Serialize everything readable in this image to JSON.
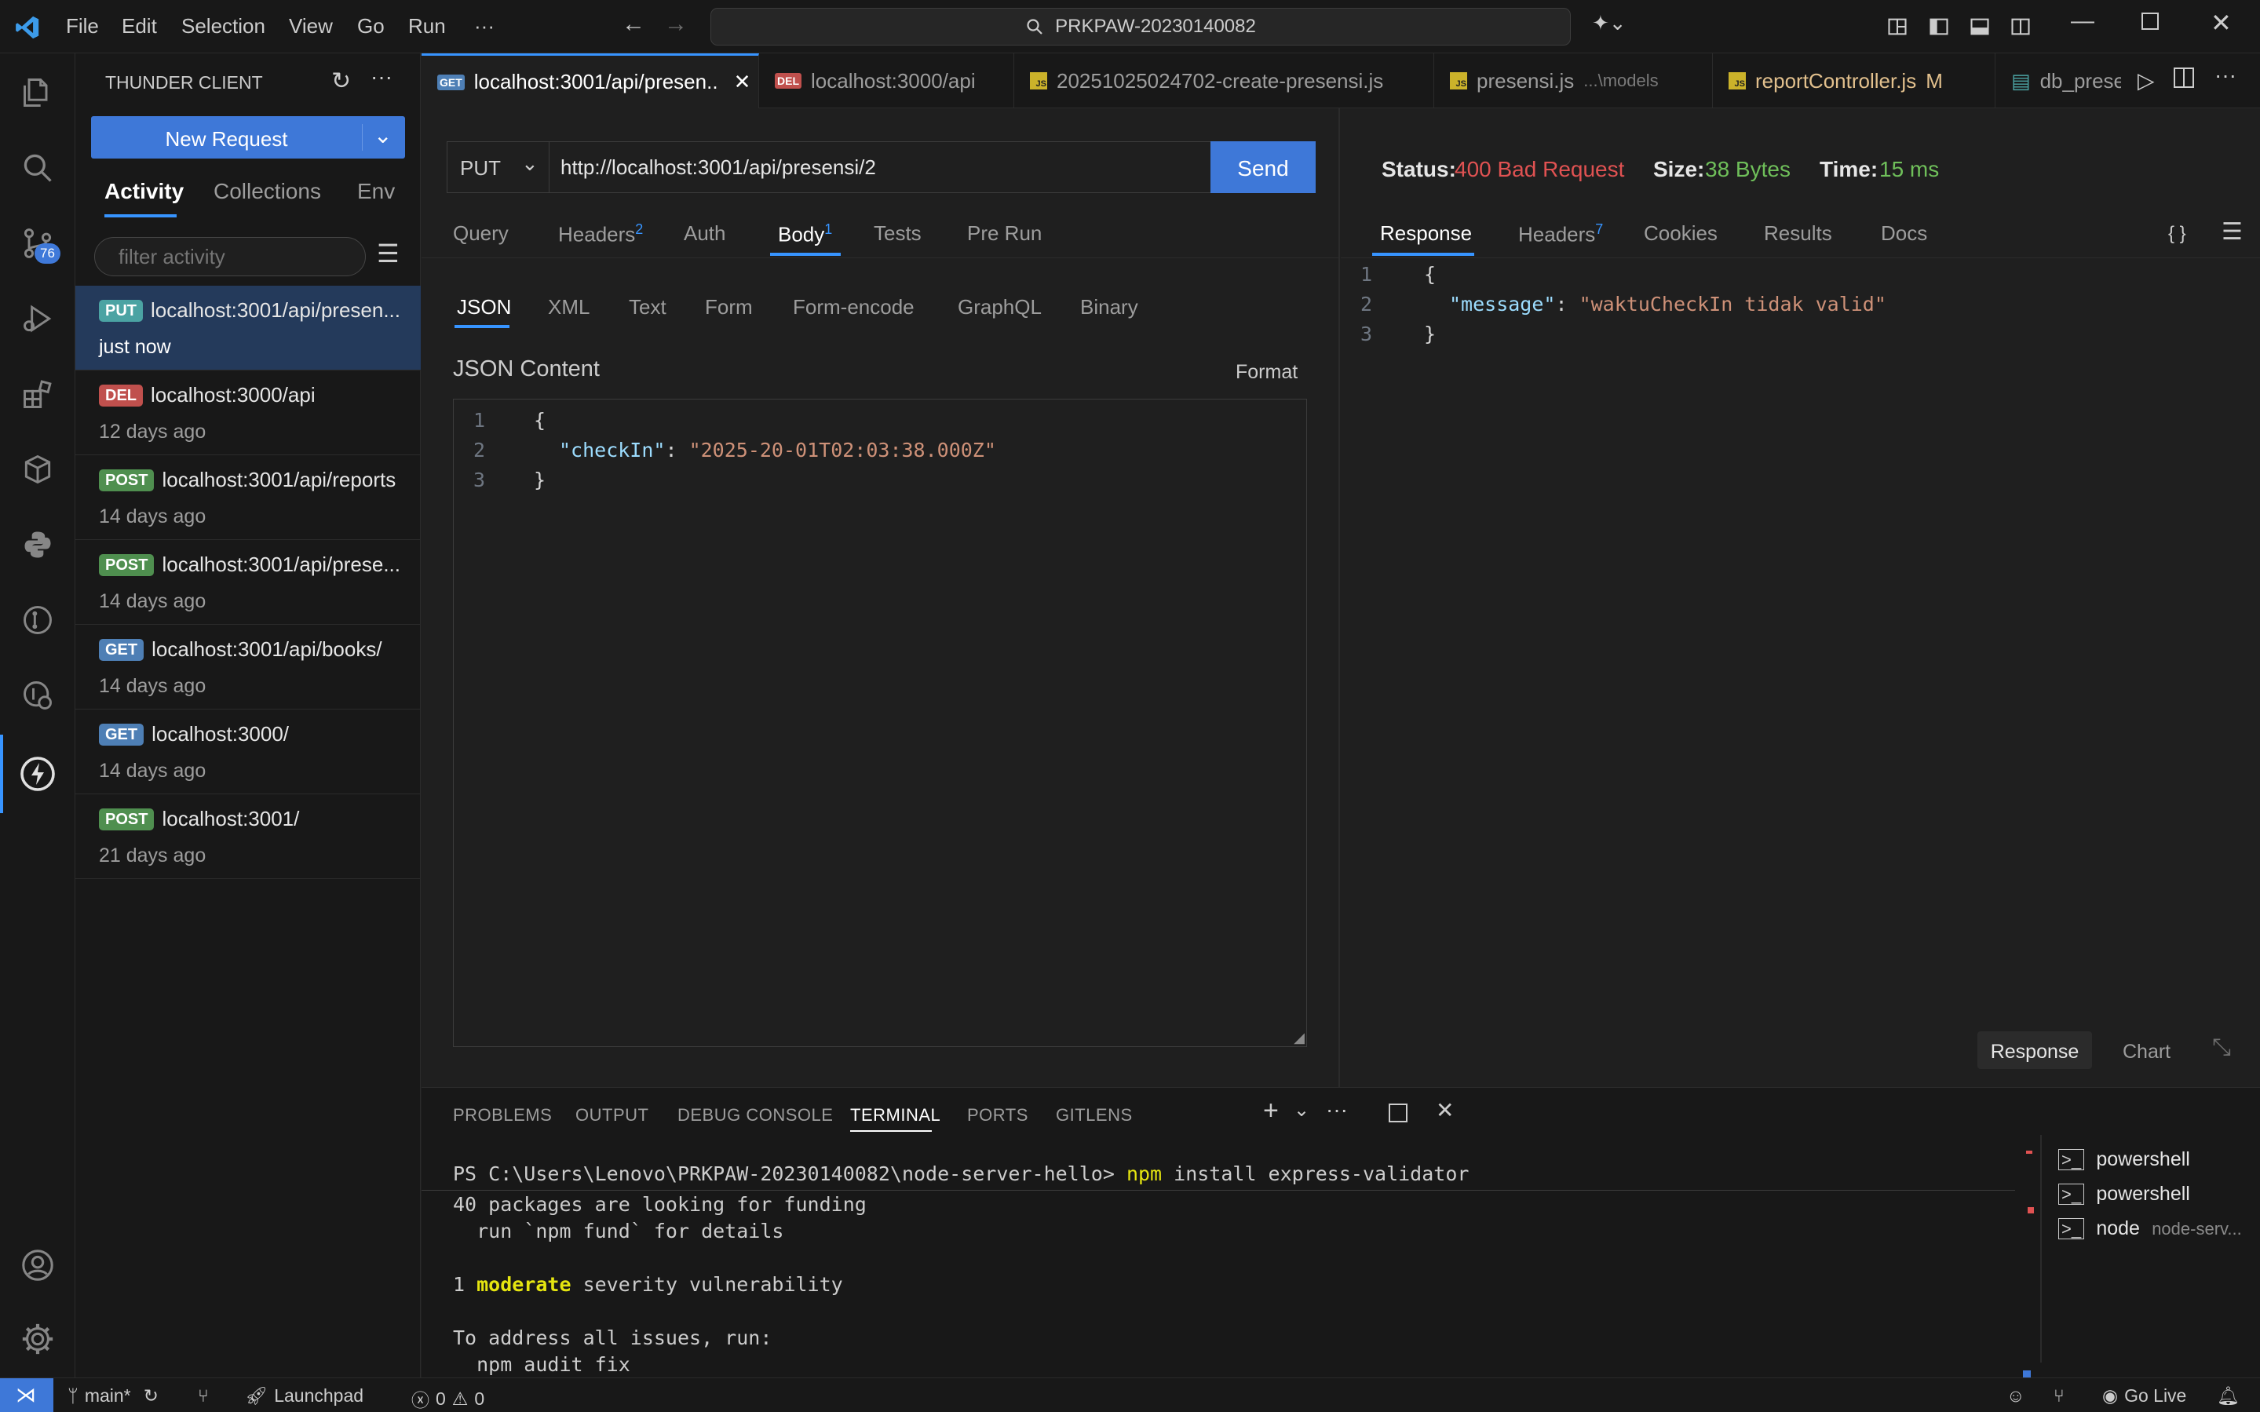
{
  "menu": [
    "File",
    "Edit",
    "Selection",
    "View",
    "Go",
    "Run",
    "···"
  ],
  "search": {
    "text": "PRKPAW-20230140082"
  },
  "activity": {
    "badge": "76"
  },
  "sidebar": {
    "title": "THUNDER CLIENT",
    "new_request": "New Request",
    "tabs": [
      "Activity",
      "Collections",
      "Env"
    ],
    "filter_placeholder": "filter activity",
    "history": [
      {
        "method": "PUT",
        "color": "#4ba3a3",
        "url": "localhost:3001/api/presen...",
        "time": "just now"
      },
      {
        "method": "DEL",
        "color": "#c0504d",
        "url": "localhost:3000/api",
        "time": "12 days ago"
      },
      {
        "method": "POST",
        "color": "#4f8f4f",
        "url": "localhost:3001/api/reports",
        "time": "14 days ago"
      },
      {
        "method": "POST",
        "color": "#4f8f4f",
        "url": "localhost:3001/api/prese...",
        "time": "14 days ago"
      },
      {
        "method": "GET",
        "color": "#4e7fb5",
        "url": "localhost:3001/api/books/",
        "time": "14 days ago"
      },
      {
        "method": "GET",
        "color": "#4e7fb5",
        "url": "localhost:3000/",
        "time": "14 days ago"
      },
      {
        "method": "POST",
        "color": "#4f8f4f",
        "url": "localhost:3001/",
        "time": "21 days ago"
      }
    ]
  },
  "tabs": {
    "t1": "localhost:3001/api/presen..",
    "t2": "localhost:3000/api",
    "t3": "20251025024702-create-presensi.js",
    "t4": "presensi.js",
    "t4_dim": "...\\models",
    "t5": "reportController.js",
    "t5_mod": "M",
    "t6": "db_prese",
    "get_tag": "GET",
    "del_tag": "DEL",
    "js_tag": "JS"
  },
  "request": {
    "method": "PUT",
    "url": "http://localhost:3001/api/presensi/2",
    "send": "Send",
    "tabs": {
      "query": "Query",
      "headers": "Headers",
      "headers_count": "2",
      "auth": "Auth",
      "body": "Body",
      "body_count": "1",
      "tests": "Tests",
      "prerun": "Pre Run"
    },
    "body_types": [
      "JSON",
      "XML",
      "Text",
      "Form",
      "Form-encode",
      "GraphQL",
      "Binary"
    ],
    "content_label": "JSON Content",
    "format": "Format",
    "lines": [
      "1",
      "2",
      "3"
    ],
    "code": {
      "open": "{",
      "key": "\"checkIn\"",
      "colon": ": ",
      "value": "\"2025-20-01T02:03:38.000Z\"",
      "close": "}"
    }
  },
  "response": {
    "status_label": "Status:",
    "status_value": "400 Bad Request",
    "size_label": "Size:",
    "size_value": "38 Bytes",
    "time_label": "Time:",
    "time_value": "15 ms",
    "tabs": {
      "response": "Response",
      "headers": "Headers",
      "headers_count": "7",
      "cookies": "Cookies",
      "results": "Results",
      "docs": "Docs"
    },
    "braces": "{ }",
    "lines": [
      "1",
      "2",
      "3"
    ],
    "code": {
      "open": "{",
      "key": "\"message\"",
      "colon": ": ",
      "value": "\"waktuCheckIn tidak valid\"",
      "close": "}"
    },
    "bottom_tabs": [
      "Response",
      "Chart"
    ]
  },
  "panel": {
    "tabs": [
      "PROBLEMS",
      "OUTPUT",
      "DEBUG CONSOLE",
      "TERMINAL",
      "PORTS",
      "GITLENS"
    ],
    "prompt": "PS C:\\Users\\Lenovo\\PRKPAW-20230140082\\node-server-hello> ",
    "cmd_npm": "npm",
    "cmd_rest": " install express-validator",
    "out1": "40 packages are looking for funding",
    "out2": "  run `npm fund` for details",
    "out3_num": "1 ",
    "out3_word": "moderate",
    "out3_rest": " severity vulnerability",
    "out4": "To address all issues, run:",
    "out5": "  npm audit fix",
    "terminals": [
      "powershell",
      "powershell",
      "node"
    ],
    "terminal3_dim": "node-serv..."
  },
  "status": {
    "branch": "main*",
    "launchpad": "Launchpad",
    "errors": "0",
    "warnings": "0",
    "golive": "Go Live"
  }
}
